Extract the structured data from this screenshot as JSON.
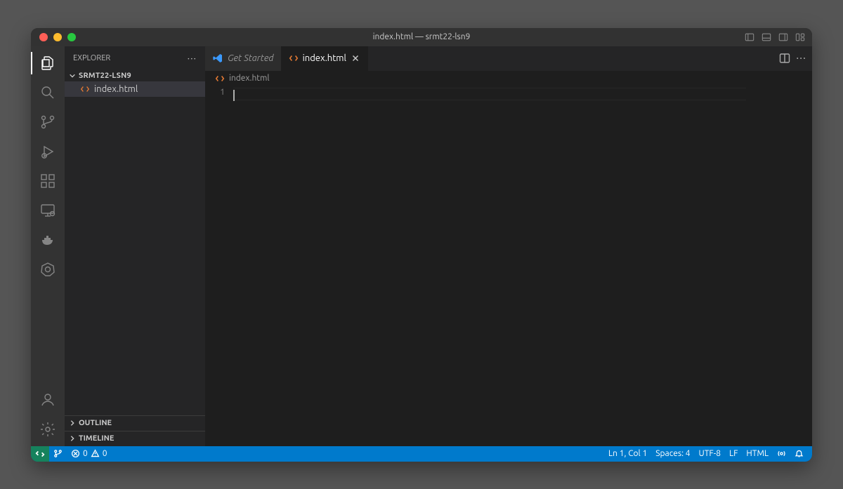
{
  "titlebar": {
    "title": "index.html — srmt22-lsn9"
  },
  "sidebar": {
    "title": "EXPLORER",
    "folder_name": "SRMT22-LSN9",
    "files": [
      {
        "name": "index.html"
      }
    ],
    "outline_label": "OUTLINE",
    "timeline_label": "TIMELINE"
  },
  "tabs": {
    "get_started": "Get Started",
    "active_file": "index.html"
  },
  "breadcrumb": {
    "file": "index.html"
  },
  "editor": {
    "line_number": "1"
  },
  "statusbar": {
    "errors": "0",
    "warnings": "0",
    "cursor": "Ln 1, Col 1",
    "spaces": "Spaces: 4",
    "encoding": "UTF-8",
    "eol": "LF",
    "language": "HTML"
  }
}
